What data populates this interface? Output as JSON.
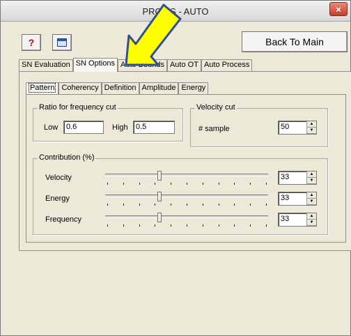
{
  "window": {
    "title": "PROFIS - AUTO",
    "close_label": "×"
  },
  "toolbar": {
    "help_label": "?",
    "back_button_label": "Back To Main"
  },
  "tabs": [
    {
      "label": "SN Evaluation",
      "active": false
    },
    {
      "label": "SN Options",
      "active": true
    },
    {
      "label": "Auto Bounds",
      "active": false
    },
    {
      "label": "Auto OT",
      "active": false
    },
    {
      "label": "Auto Process",
      "active": false
    }
  ],
  "subtabs": [
    {
      "label": "Pattern",
      "active": true
    },
    {
      "label": "Coherency",
      "active": false
    },
    {
      "label": "Definition",
      "active": false
    },
    {
      "label": "Amplitude",
      "active": false
    },
    {
      "label": "Energy",
      "active": false
    }
  ],
  "ratio_group": {
    "title": "Ratio for frequency cut",
    "low_label": "Low",
    "low_value": "0.6",
    "high_label": "High",
    "high_value": "0.5"
  },
  "velocity_group": {
    "title": "Velocity cut",
    "sample_label": "# sample",
    "sample_value": "50"
  },
  "contribution_group": {
    "title": "Contribution (%)",
    "rows": [
      {
        "label": "Velocity",
        "value": "33",
        "level": 0.33
      },
      {
        "label": "Energy",
        "value": "33",
        "level": 0.33
      },
      {
        "label": "Frequency",
        "value": "33",
        "level": 0.33
      }
    ]
  },
  "colors": {
    "arrow_fill": "#ffff00",
    "arrow_stroke": "#2f4f8f",
    "window_bg": "#ece9d8"
  },
  "icons": {
    "help": "help-icon",
    "window": "window-icon",
    "close": "close-icon",
    "arrow": "pointer-arrow"
  }
}
